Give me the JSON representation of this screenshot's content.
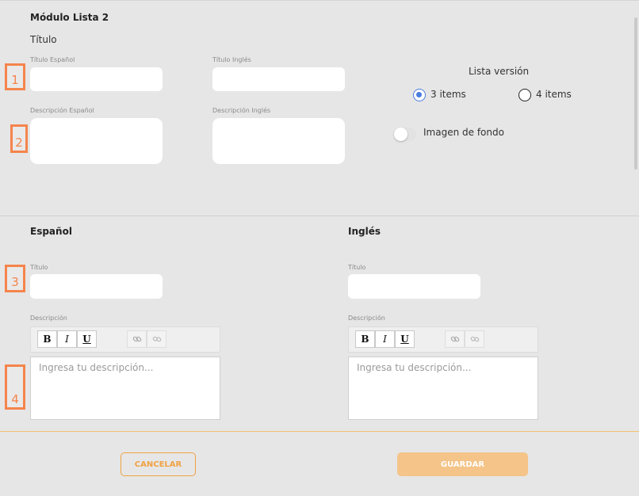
{
  "module": {
    "title": "Módulo Lista 2",
    "subtitle": "Título"
  },
  "top_form": {
    "titulo_es_label": "Título Español",
    "titulo_es_value": "",
    "titulo_en_label": "Título Inglés",
    "titulo_en_value": "",
    "desc_es_label": "Descripción Español",
    "desc_es_value": "",
    "desc_en_label": "Descripción Inglés",
    "desc_en_value": ""
  },
  "lista": {
    "title": "Lista versión",
    "options": [
      {
        "label": "3 items",
        "selected": true
      },
      {
        "label": "4 items",
        "selected": false
      }
    ]
  },
  "imagen": {
    "label": "Imagen de fondo",
    "enabled": false
  },
  "markers": [
    "1",
    "2",
    "3",
    "4"
  ],
  "espanol": {
    "heading": "Español",
    "titulo_label": "Título",
    "titulo_value": "",
    "desc_label": "Descripción",
    "placeholder": "Ingresa tu descripción..."
  },
  "ingles": {
    "heading": "Inglés",
    "titulo_label": "Título",
    "titulo_value": "",
    "desc_label": "Descripción",
    "placeholder": "Ingresa tu descripción..."
  },
  "toolbar": {
    "bold": "B",
    "italic": "I",
    "underline": "U",
    "link_icon": "link-icon",
    "unlink_icon": "unlink-icon"
  },
  "buttons": {
    "cancel": "CANCELAR",
    "save": "GUARDAR"
  },
  "colors": {
    "accent": "#f5844c",
    "button_orange": "#f0a244",
    "save_disabled": "#f4c489",
    "radio_blue": "#4a7de0",
    "background": "#e6e6e6"
  }
}
